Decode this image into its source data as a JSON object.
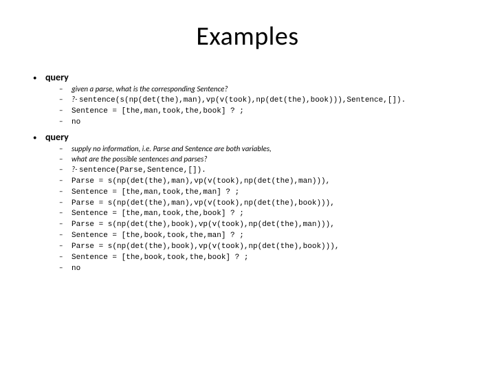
{
  "title": "Examples",
  "sections": [
    {
      "label": "query",
      "items": [
        {
          "type": "italic",
          "text": "given a parse, what is the corresponding Sentence?"
        },
        {
          "type": "mixed",
          "prefix": "?- ",
          "code": "sentence(s(np(det(the),man),vp(v(took),np(det(the),book))),Sentence,[])."
        },
        {
          "type": "mono",
          "text": "Sentence = [the,man,took,the,book] ? ;"
        },
        {
          "type": "mono",
          "text": "no"
        }
      ]
    },
    {
      "label": "query",
      "items": [
        {
          "type": "italic",
          "text": "supply no information, i.e. Parse and Sentence are both variables,"
        },
        {
          "type": "italic",
          "text": "what are the possible sentences and parses?"
        },
        {
          "type": "mixed",
          "prefix": "?- ",
          "code": "sentence(Parse,Sentence,[])."
        },
        {
          "type": "mono",
          "text": "Parse = s(np(det(the),man),vp(v(took),np(det(the),man))),"
        },
        {
          "type": "mono",
          "text": "Sentence = [the,man,took,the,man] ? ;"
        },
        {
          "type": "mono",
          "text": "Parse = s(np(det(the),man),vp(v(took),np(det(the),book))),"
        },
        {
          "type": "mono",
          "text": "Sentence = [the,man,took,the,book] ? ;"
        },
        {
          "type": "mono",
          "text": "Parse = s(np(det(the),book),vp(v(took),np(det(the),man))),"
        },
        {
          "type": "mono",
          "text": "Sentence = [the,book,took,the,man] ? ;"
        },
        {
          "type": "mono",
          "text": "Parse = s(np(det(the),book),vp(v(took),np(det(the),book))),"
        },
        {
          "type": "mono",
          "text": "Sentence = [the,book,took,the,book] ? ;"
        },
        {
          "type": "mono",
          "text": "no"
        }
      ]
    }
  ]
}
